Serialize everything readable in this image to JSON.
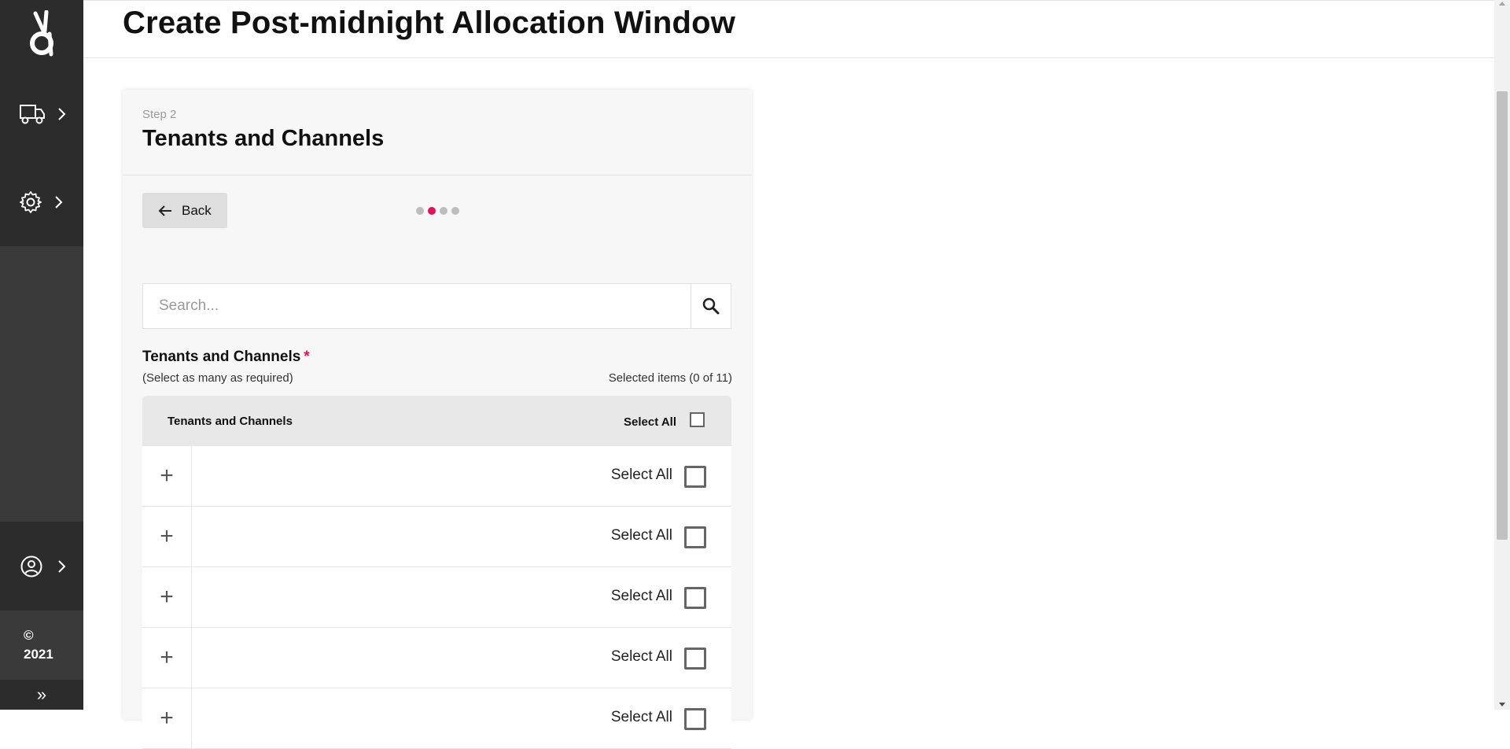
{
  "sidebar": {
    "logo_icon": "brand-logo-icon",
    "items": [
      {
        "icon": "truck-icon",
        "chevron": "chevron-right-icon"
      },
      {
        "icon": "gear-icon",
        "chevron": "chevron-right-icon"
      }
    ],
    "user": {
      "icon": "user-circle-icon"
    },
    "copyright_symbol": "©",
    "copyright_year": "2021",
    "expand_glyph": "»"
  },
  "header": {
    "title": "Create Post-midnight Allocation Window"
  },
  "card": {
    "step_label": "Step 2",
    "title": "Tenants and Channels",
    "back_label": "Back",
    "steps_total": 4,
    "current_step": 2,
    "accent_color": "#e0115f"
  },
  "search": {
    "placeholder": "Search...",
    "value": ""
  },
  "field": {
    "label": "Tenants and Channels",
    "required_mark": "*",
    "hint": "(Select as many as required)",
    "selected_text": "Selected items (0 of 11)"
  },
  "table": {
    "header_title": "Tenants and Channels",
    "header_select_all": "Select All",
    "rows": [
      {
        "toggle": "+",
        "name": "",
        "sub": "",
        "select_all": "Select All",
        "checked": false
      },
      {
        "toggle": "+",
        "name": "",
        "sub": "",
        "select_all": "Select All",
        "checked": false
      },
      {
        "toggle": "+",
        "name": "",
        "sub": "",
        "select_all": "Select All",
        "checked": false
      },
      {
        "toggle": "+",
        "name": "",
        "sub": "",
        "select_all": "Select All",
        "checked": false
      },
      {
        "toggle": "+",
        "name": "",
        "sub": "",
        "select_all": "Select All",
        "checked": false
      }
    ]
  }
}
